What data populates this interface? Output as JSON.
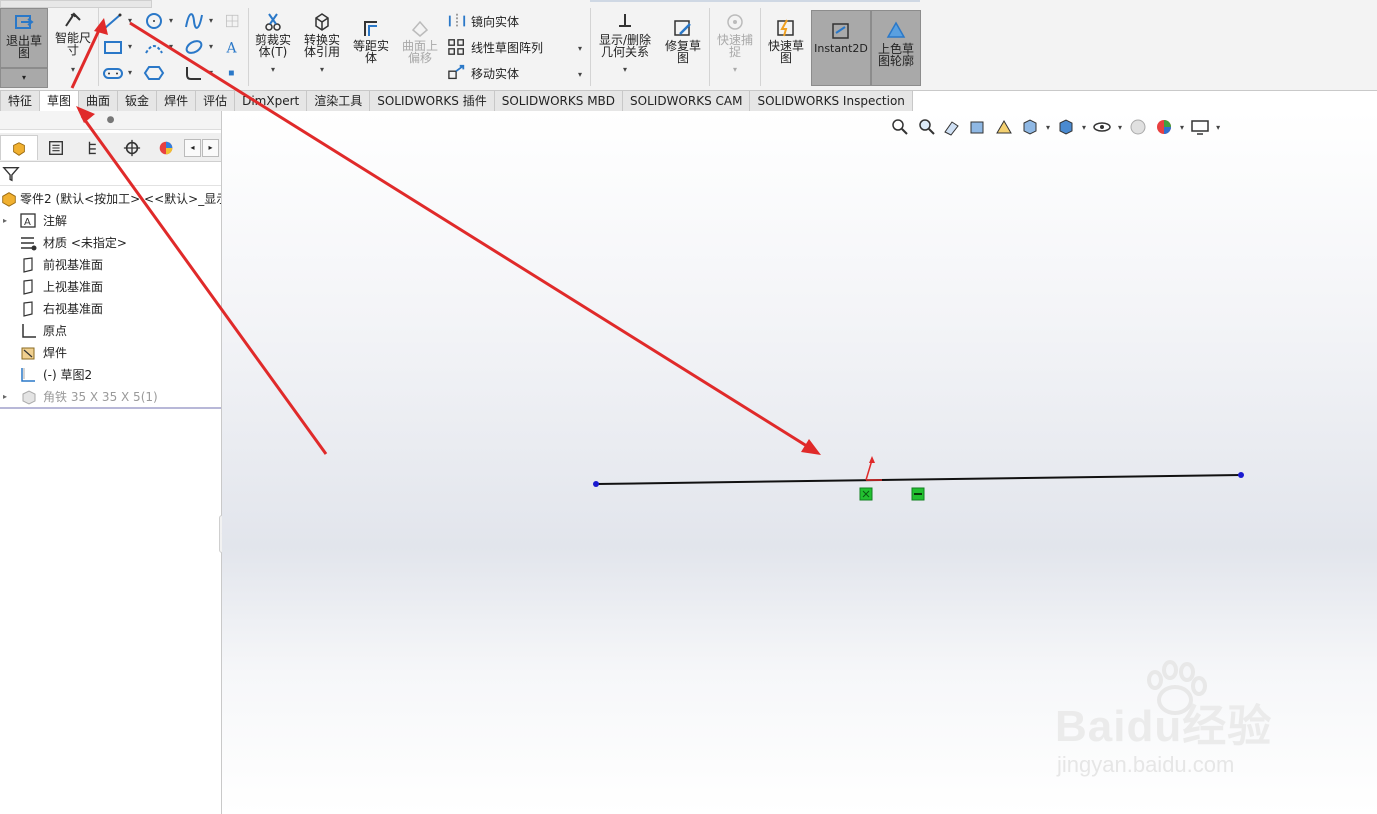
{
  "ribbon": {
    "exit_sketch": "退出草图",
    "smart_dimension": "智能尺寸",
    "trim": "剪裁实体(T)",
    "convert": "转换实体引用",
    "offset": "等距实体",
    "surface_offset": "曲面上偏移",
    "mirror": "镜向实体",
    "linear_pattern": "线性草图阵列",
    "move": "移动实体",
    "display_delete": "显示/删除几何关系",
    "repair": "修复草图",
    "quick_snap": "快速捕捉",
    "rapid_sketch": "快速草图",
    "instant2d": "Instant2D",
    "shaded_contours": "上色草图轮廓"
  },
  "tabs": [
    "特征",
    "草图",
    "曲面",
    "钣金",
    "焊件",
    "评估",
    "DimXpert",
    "渲染工具",
    "SOLIDWORKS 插件",
    "SOLIDWORKS MBD",
    "SOLIDWORKS CAM",
    "SOLIDWORKS Inspection"
  ],
  "tree": {
    "root": "零件2 (默认<按加工> <<默认>_显示",
    "items": [
      "注解",
      "材质 <未指定>",
      "前视基准面",
      "上视基准面",
      "右视基准面",
      "原点",
      "焊件",
      "(-) 草图2",
      "角铁 35 X 35 X 5(1)"
    ]
  },
  "watermark": {
    "brand": "Baidu经验",
    "url": "jingyan.baidu.com"
  },
  "colors": {
    "arrow": "#e02a2a",
    "line": "#111111",
    "endpoint": "#1a1ad0",
    "constraint": "#22c030",
    "pressed": "#a9a9a9"
  },
  "icons": [
    "exit-sketch-icon",
    "smart-dimension-icon",
    "line-icon",
    "rectangle-icon",
    "slot-icon",
    "circle-icon",
    "arc-icon",
    "polygon-icon",
    "spline-icon",
    "ellipse-icon",
    "fillet-icon",
    "text-icon",
    "point-icon",
    "trim-icon",
    "convert-icon",
    "offset-icon",
    "mirror-icon",
    "pattern-icon",
    "move-icon",
    "relations-icon",
    "repair-icon",
    "quick-snap-icon",
    "rapid-sketch-icon",
    "instant2d-icon",
    "shaded-sketch-icon"
  ]
}
